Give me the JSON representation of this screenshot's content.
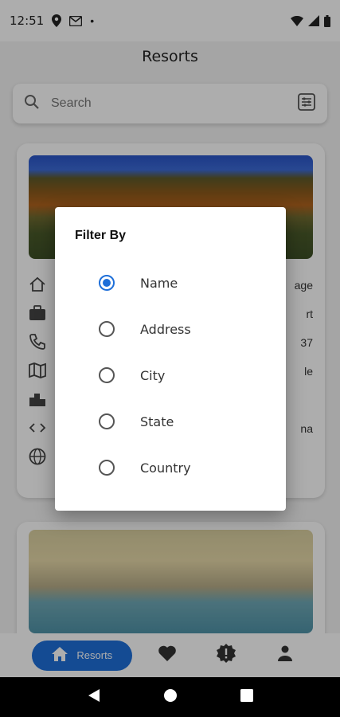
{
  "status_bar": {
    "time": "12:51",
    "dot": "•"
  },
  "app": {
    "title": "Resorts"
  },
  "search": {
    "placeholder": "Search"
  },
  "cards": [
    {
      "info_rows": [
        "age",
        "rt",
        "37",
        "le",
        "",
        "na",
        ""
      ]
    },
    {
      "info_rows": []
    }
  ],
  "bottom_nav": {
    "active_label": "Resorts",
    "items": [
      "home-icon",
      "heart-icon",
      "badge-alert-icon",
      "person-icon"
    ]
  },
  "dialog": {
    "title": "Filter By",
    "selected": "Name",
    "options": [
      {
        "label": "Name",
        "checked": true
      },
      {
        "label": "Address",
        "checked": false
      },
      {
        "label": "City",
        "checked": false
      },
      {
        "label": "State",
        "checked": false
      },
      {
        "label": "Country",
        "checked": false
      }
    ]
  },
  "colors": {
    "accent": "#1e6fd9",
    "scrim": "rgba(0,0,0,0.32)",
    "android_nav": "#000000"
  }
}
